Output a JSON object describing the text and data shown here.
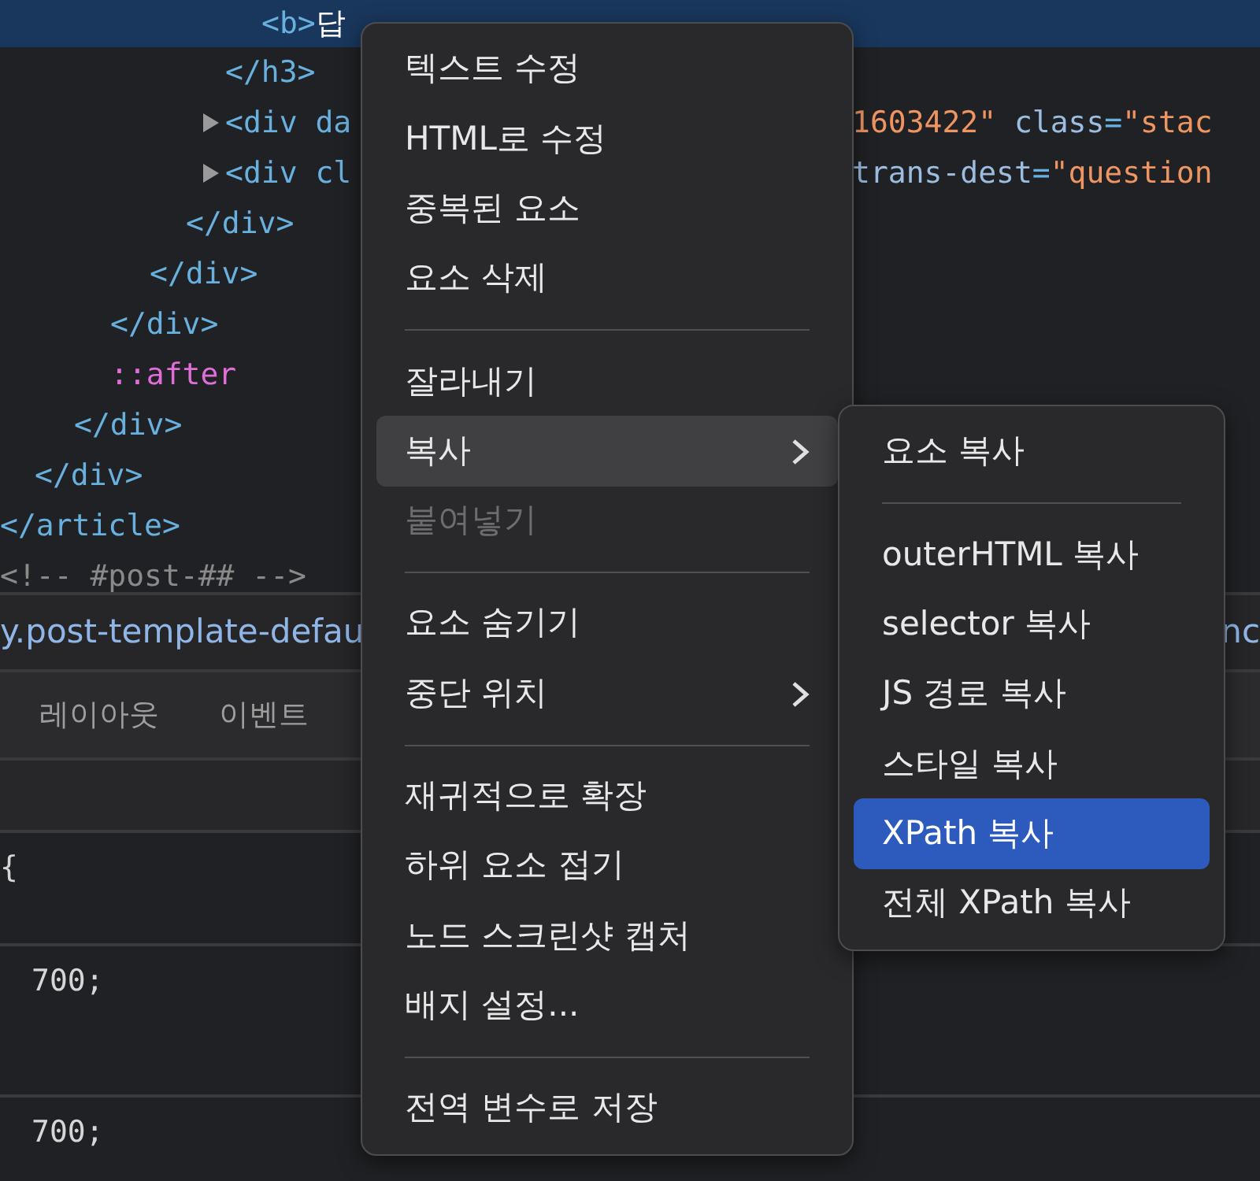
{
  "dom_tree": [
    {
      "selected": true,
      "tokens": [
        {
          "kind": "tag",
          "text": "<b>"
        },
        {
          "kind": "text",
          "text": "답"
        }
      ]
    },
    {
      "selected": false,
      "tokens": [
        {
          "kind": "tag",
          "text": "</h3>"
        }
      ]
    },
    {
      "selected": false,
      "expanded": false,
      "tokens": [
        {
          "kind": "tag",
          "text": "<div da"
        }
      ],
      "tail": [
        {
          "kind": "value",
          "text": "1603422\""
        },
        {
          "kind": "attr",
          "text": " class"
        },
        {
          "kind": "tag",
          "text": "="
        },
        {
          "kind": "value",
          "text": "\"stac"
        }
      ]
    },
    {
      "selected": false,
      "expanded": false,
      "tokens": [
        {
          "kind": "tag",
          "text": "<div cl"
        }
      ],
      "tail": [
        {
          "kind": "attr",
          "text": "trans-dest"
        },
        {
          "kind": "tag",
          "text": "="
        },
        {
          "kind": "value",
          "text": "\"question"
        }
      ]
    },
    {
      "selected": false,
      "tokens": [
        {
          "kind": "tag",
          "text": "</div>"
        }
      ]
    },
    {
      "selected": false,
      "tokens": [
        {
          "kind": "tag",
          "text": "</div>"
        }
      ]
    },
    {
      "selected": false,
      "tokens": [
        {
          "kind": "tag",
          "text": "</div>"
        }
      ]
    },
    {
      "selected": false,
      "tokens": [
        {
          "kind": "pseudo",
          "text": "::after"
        }
      ]
    },
    {
      "selected": false,
      "tokens": [
        {
          "kind": "tag",
          "text": "</div>"
        }
      ]
    },
    {
      "selected": false,
      "tokens": [
        {
          "kind": "tag",
          "text": "</div>"
        }
      ]
    },
    {
      "selected": false,
      "tokens": [
        {
          "kind": "tag",
          "text": "</article>"
        }
      ]
    },
    {
      "selected": false,
      "tokens": [
        {
          "kind": "comment",
          "text": "<!-- #post-## -->"
        }
      ]
    }
  ],
  "breadcrumb": {
    "left": "y.post-template-defau",
    "right": "nc"
  },
  "tabs": [
    {
      "label": "레이아웃"
    },
    {
      "label": "이벤트"
    }
  ],
  "styles": [
    {
      "text": "{"
    },
    {
      "text": "700;"
    },
    {
      "text": "700;"
    }
  ],
  "context_menu": [
    {
      "kind": "item",
      "label": "텍스트 수정",
      "selected": false,
      "disabled": false
    },
    {
      "kind": "item",
      "label": "HTML로 수정",
      "selected": false,
      "disabled": false
    },
    {
      "kind": "item",
      "label": "중복된 요소",
      "selected": false,
      "disabled": false
    },
    {
      "kind": "item",
      "label": "요소 삭제",
      "selected": false,
      "disabled": false
    },
    {
      "kind": "separator"
    },
    {
      "kind": "item",
      "label": "잘라내기",
      "selected": false,
      "disabled": false
    },
    {
      "kind": "item",
      "label": "복사",
      "selected": true,
      "disabled": false,
      "submenu": true
    },
    {
      "kind": "item",
      "label": "붙여넣기",
      "selected": false,
      "disabled": true
    },
    {
      "kind": "separator"
    },
    {
      "kind": "item",
      "label": "요소 숨기기",
      "selected": false,
      "disabled": false
    },
    {
      "kind": "item",
      "label": "중단 위치",
      "selected": false,
      "disabled": false,
      "submenu": true
    },
    {
      "kind": "separator"
    },
    {
      "kind": "item",
      "label": "재귀적으로 확장",
      "selected": false,
      "disabled": false
    },
    {
      "kind": "item",
      "label": "하위 요소 접기",
      "selected": false,
      "disabled": false
    },
    {
      "kind": "item",
      "label": "노드 스크린샷 캡처",
      "selected": false,
      "disabled": false
    },
    {
      "kind": "item",
      "label": "배지 설정...",
      "selected": false,
      "disabled": false
    },
    {
      "kind": "separator"
    },
    {
      "kind": "item",
      "label": "전역 변수로 저장",
      "selected": false,
      "disabled": false
    }
  ],
  "submenu": [
    {
      "kind": "item",
      "label": "요소 복사",
      "selected": false
    },
    {
      "kind": "separator"
    },
    {
      "kind": "item",
      "label": "outerHTML 복사",
      "selected": false
    },
    {
      "kind": "item",
      "label": "selector 복사",
      "selected": false
    },
    {
      "kind": "item",
      "label": "JS 경로 복사",
      "selected": false
    },
    {
      "kind": "item",
      "label": "스타일 복사",
      "selected": false
    },
    {
      "kind": "item",
      "label": "XPath 복사",
      "selected": true
    },
    {
      "kind": "item",
      "label": "전체 XPath 복사",
      "selected": false
    }
  ]
}
